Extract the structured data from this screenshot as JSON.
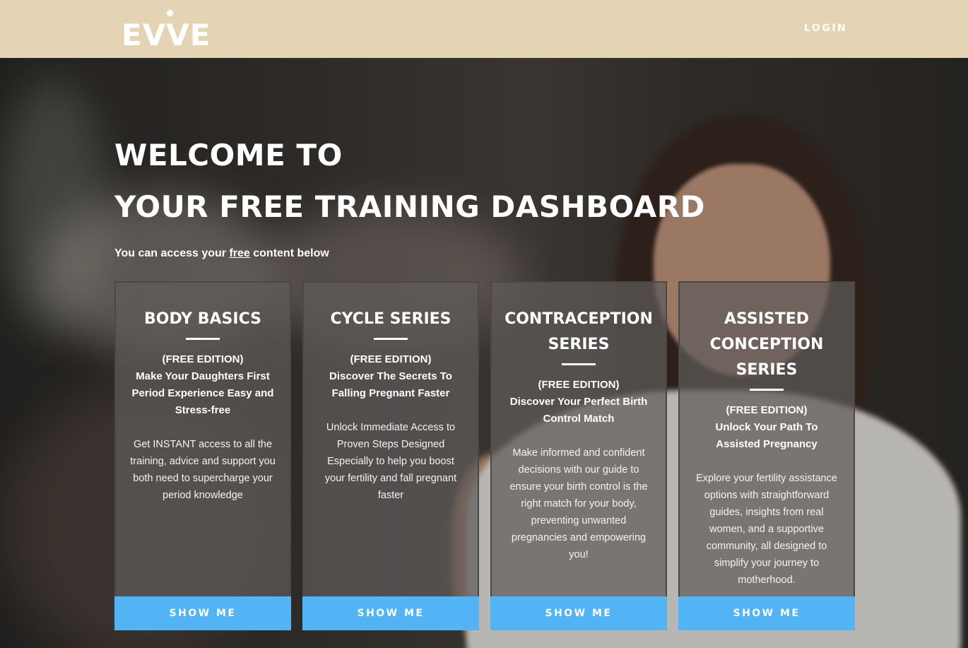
{
  "header": {
    "logo_text": "EVVE",
    "login_label": "LOGIN"
  },
  "hero": {
    "title_line1": "WELCOME TO",
    "title_line2": "YOUR FREE TRAINING DASHBOARD",
    "subtitle_before": "You can access your ",
    "subtitle_link": "free",
    "subtitle_after": " content below"
  },
  "cards": [
    {
      "title": "BODY BASICS",
      "edition": "(FREE EDITION)",
      "headline": "Make Your Daughters First Period Experience Easy and Stress-free",
      "description": "Get INSTANT access to all the training, advice and support you both need to supercharge your period knowledge",
      "button_label": "SHOW ME"
    },
    {
      "title": "CYCLE SERIES",
      "edition": "(FREE EDITION)",
      "headline": "Discover The Secrets To Falling Pregnant Faster",
      "description": "Unlock Immediate Access to Proven Steps Designed Especially to help you boost your fertility and fall pregnant faster",
      "button_label": "SHOW ME"
    },
    {
      "title": "CONTRACEPTION SERIES",
      "edition": "(FREE EDITION)",
      "headline": "Discover Your Perfect Birth Control Match",
      "description": "Make informed and confident decisions with our guide to ensure your birth control is the right match for your body, preventing unwanted pregnancies and empowering you!",
      "button_label": "SHOW ME"
    },
    {
      "title": "ASSISTED CONCEPTION SERIES",
      "edition": "(FREE EDITION)",
      "headline": "Unlock Your Path To Assisted Pregnancy",
      "description": "Explore your fertility assistance options with straightforward guides, insights from real women, and a supportive community, all designed to simplify your journey to motherhood.",
      "button_label": "SHOW ME"
    }
  ],
  "colors": {
    "header_bg": "#e5d4b3",
    "button_bg": "#52b3f5",
    "card_bg": "rgba(95,92,90,0.72)"
  }
}
